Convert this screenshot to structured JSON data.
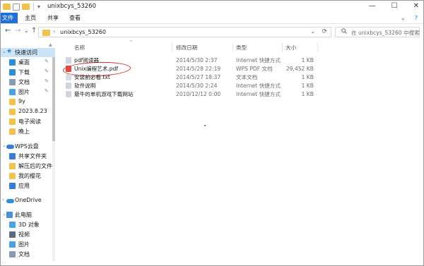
{
  "window": {
    "title": "unixbcys_53260",
    "minimize": "—",
    "maximize": "☐",
    "close": "✕"
  },
  "ribbon": {
    "tabs": [
      "文件",
      "主页",
      "共享",
      "查看"
    ],
    "expand": "⌄",
    "help": "?"
  },
  "nav": {
    "back": "←",
    "forward": "→",
    "dropdown": "⌄",
    "up": "↑"
  },
  "address": {
    "chevron": "›",
    "path": "unixbcys_53260",
    "drop": "⌄",
    "refresh": "⟳"
  },
  "search": {
    "placeholder": "在 unixbcys_53260 中搜索"
  },
  "sidebar": {
    "items": [
      {
        "label": "快速访问",
        "icon": "star-icon",
        "color": "#2b7cd3",
        "level": 0,
        "chevron": "⌄",
        "selected": true
      },
      {
        "label": "桌面",
        "icon": "desktop-icon",
        "color": "#2f8fd6",
        "level": 1,
        "pin": "✎"
      },
      {
        "label": "下载",
        "icon": "download-icon",
        "color": "#2f8fd6",
        "level": 1,
        "pin": "✎"
      },
      {
        "label": "文档",
        "icon": "document-icon",
        "color": "#8a9bb0",
        "level": 1,
        "pin": "✎"
      },
      {
        "label": "图片",
        "icon": "picture-icon",
        "color": "#4aa3df",
        "level": 1,
        "pin": "✎"
      },
      {
        "label": "9y",
        "icon": "folder-icon",
        "color": "#f2c14e",
        "level": 1
      },
      {
        "label": "2023.8.23",
        "icon": "folder-icon",
        "color": "#f2c14e",
        "level": 1
      },
      {
        "label": "电子阅读",
        "icon": "folder-icon",
        "color": "#f2c14e",
        "level": 1
      },
      {
        "label": "晚上",
        "icon": "folder-icon",
        "color": "#f2c14e",
        "level": 1
      },
      {
        "label": "WPS云盘",
        "icon": "cloud-icon",
        "color": "#3a7bd5",
        "level": 0,
        "chevron": "⌄"
      },
      {
        "label": "共享文件夹",
        "icon": "shared-folder-icon",
        "color": "#3a7bd5",
        "level": 1
      },
      {
        "label": "解压后的文件",
        "icon": "folder-icon",
        "color": "#f2c14e",
        "level": 1
      },
      {
        "label": "我的樱花",
        "icon": "folder-icon",
        "color": "#f2c14e",
        "level": 1
      },
      {
        "label": "应用",
        "icon": "app-icon",
        "color": "#3a7bd5",
        "level": 1
      },
      {
        "label": "OneDrive",
        "icon": "onedrive-icon",
        "color": "#2f8fd6",
        "level": 0,
        "chevron": "›"
      },
      {
        "label": "此电脑",
        "icon": "computer-icon",
        "color": "#4a90d9",
        "level": 0,
        "chevron": "⌄"
      },
      {
        "label": "3D 对象",
        "icon": "cube-icon",
        "color": "#49a6e0",
        "level": 1
      },
      {
        "label": "视频",
        "icon": "video-icon",
        "color": "#5a6a80",
        "level": 1
      },
      {
        "label": "图片",
        "icon": "picture-icon",
        "color": "#4aa3df",
        "level": 1
      },
      {
        "label": "文档",
        "icon": "document-icon",
        "color": "#8a9bb0",
        "level": 1
      }
    ]
  },
  "columns": {
    "name": "名称",
    "date": "修改日期",
    "type": "类型",
    "size": "大小",
    "sort": "^"
  },
  "files": [
    {
      "name": "pdf阅读器",
      "date": "2014/5/30 2:37",
      "type": "Internet 快捷方式",
      "size": "1 KB",
      "icon": "link-icon",
      "color": "#cfd6df"
    },
    {
      "name": "Unix编程艺术.pdf",
      "date": "2014/5/28 22:19",
      "type": "WPS PDF 文档",
      "size": "29,452 KB",
      "icon": "pdf-icon",
      "color": "#e0483f"
    },
    {
      "name": "安装前必看.txt",
      "date": "2014/5/27 18:37",
      "type": "文本文档",
      "size": "1 KB",
      "icon": "text-file-icon",
      "color": "#d8dde3"
    },
    {
      "name": "软件说明",
      "date": "2014/5/30 2:24",
      "type": "Internet 快捷方式",
      "size": "1 KB",
      "icon": "link-icon",
      "color": "#cfd6df"
    },
    {
      "name": "最牛的单机游戏下载网站",
      "date": "2010/12/12 0:00",
      "type": "Internet 快捷方式",
      "size": "1 KB",
      "icon": "link-icon",
      "color": "#cfd6df"
    }
  ],
  "colors": {
    "accent": "#1e6fd9",
    "selection": "#cce4f7",
    "annotation": "#d6262b"
  }
}
